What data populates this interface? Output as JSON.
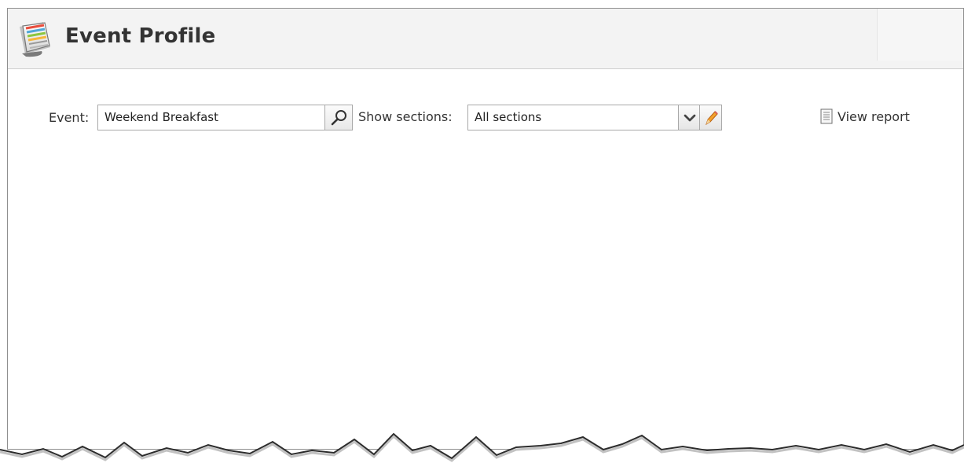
{
  "page": {
    "title": "Event Profile",
    "icon": "event-calendar-icon"
  },
  "toolbar": {
    "event_label": "Event:",
    "event_value": "Weekend Breakfast",
    "search_icon": "magnifier-icon",
    "show_sections_label": "Show sections:",
    "sections_value": "All sections",
    "dropdown_icon": "chevron-down-icon",
    "edit_icon": "pencil-icon",
    "view_report_label": "View report",
    "view_report_icon": "document-icon"
  },
  "colors": {
    "header_background": "#f3f3f3",
    "border": "#a9a9a9",
    "text": "#333333"
  }
}
